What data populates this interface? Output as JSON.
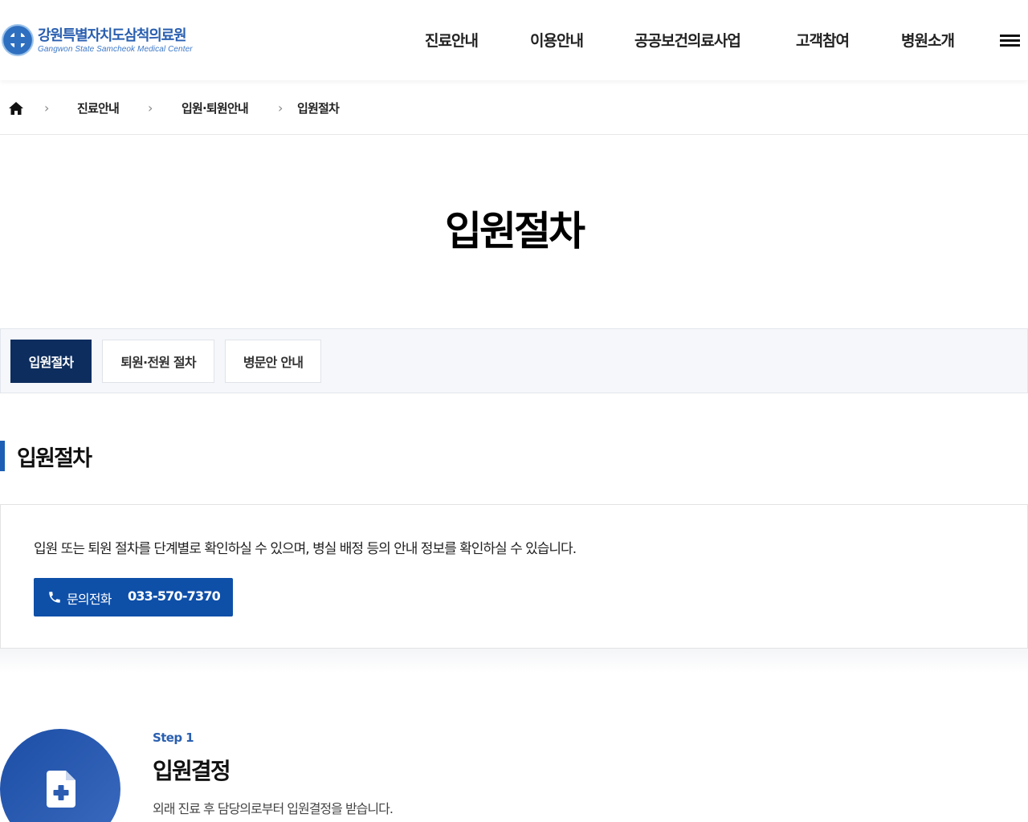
{
  "header": {
    "logo_ko": "강원특별자치도삼척의료원",
    "logo_en": "Gangwon State Samcheok Medical Center",
    "nav": [
      "진료안내",
      "이용안내",
      "공공보건의료사업",
      "고객참여",
      "병원소개"
    ],
    "menu_icon": "hamburger-icon"
  },
  "breadcrumb": {
    "home_icon": "home-icon",
    "items": [
      "진료안내",
      "입원·퇴원안내",
      "입원절차"
    ]
  },
  "page_title": "입원절차",
  "tabs": [
    {
      "label": "입원절차",
      "active": true
    },
    {
      "label": "퇴원·전원 절차",
      "active": false
    },
    {
      "label": "병문안 안내",
      "active": false
    }
  ],
  "section_title": "입원절차",
  "info": {
    "text": "입원 또는 퇴원 절차를 단계별로 확인하실 수 있으며, 병실 배정 등의 안내 정보를 확인하실 수 있습니다.",
    "call_label": "문의전화",
    "call_number": "033-570-7370",
    "call_icon": "phone-icon"
  },
  "step": {
    "number": "Step 1",
    "title": "입원결정",
    "desc": "외래 진료 후 담당의로부터 입원결정을 받습니다.",
    "icon": "medical-document-icon"
  },
  "colors": {
    "brand": "#2a5fb0",
    "tab_active": "#0d2d5e",
    "button": "#0e4fa8"
  }
}
